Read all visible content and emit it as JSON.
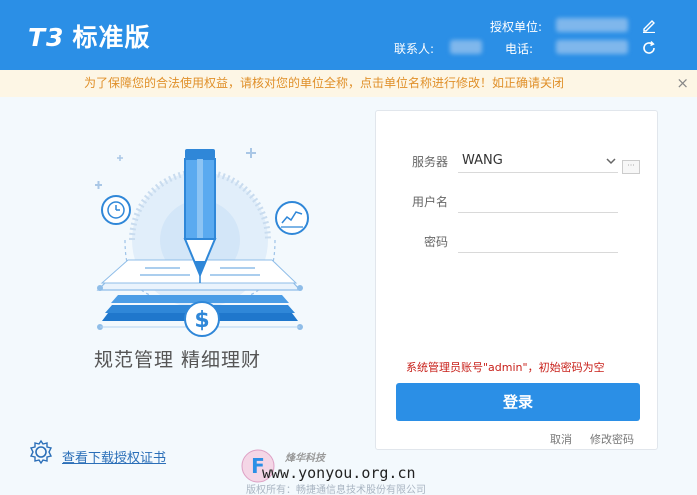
{
  "header": {
    "product_code": "T3",
    "product_name": "标准版",
    "license_unit_label": "授权单位:",
    "contact_label": "联系人:",
    "phone_label": "电话:"
  },
  "notice": {
    "text": "为了保障您的合法使用权益，请核对您的单位全称，点击单位名称进行修改！如正确请关闭",
    "close": "×"
  },
  "promo": {
    "slogan": "规范管理  精细理财"
  },
  "login": {
    "server_label": "服务器",
    "server_value": "WANG",
    "more_label": "···",
    "username_label": "用户名",
    "username_value": "",
    "password_label": "密码",
    "password_value": "",
    "hint": "系统管理员账号\"admin\"，初始密码为空",
    "login_button": "登录",
    "cancel_link": "取消",
    "change_password_link": "修改密码"
  },
  "license_cert_link": "查看下载授权证书",
  "watermark": {
    "cn_text": "烽华科技",
    "url": "www.yonyou.org.cn"
  },
  "footer": "版权所有：畅捷通信息技术股份有限公司",
  "colors": {
    "primary": "#2b8fe6",
    "notice_bg": "#fdf6e5",
    "notice_text": "#e0902a",
    "hint": "#c8211b"
  },
  "icons": {
    "edit": "pencil-icon",
    "refresh": "refresh-icon",
    "close": "close-icon",
    "cert": "gear-icon",
    "dropdown": "chevron-down-icon"
  }
}
